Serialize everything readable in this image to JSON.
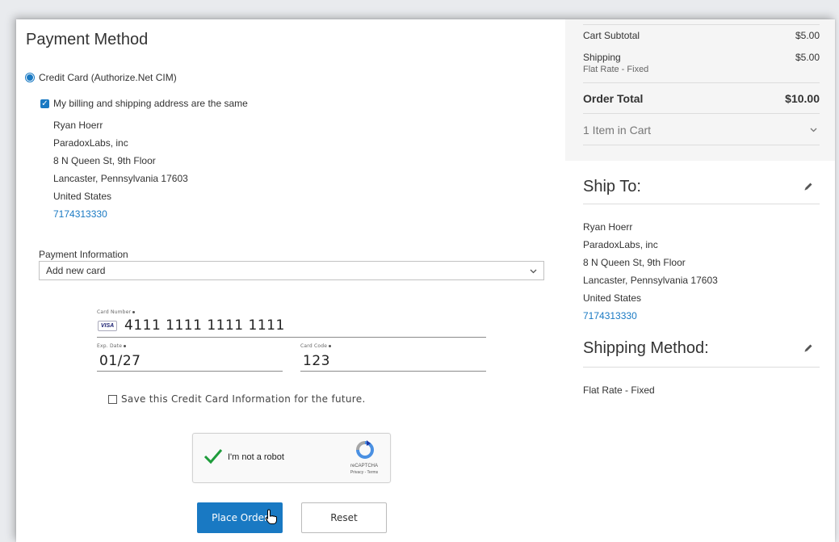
{
  "payment": {
    "title": "Payment Method",
    "method_label": "Credit Card (Authorize.Net CIM)",
    "same_address_label": "My billing and shipping address are the same",
    "billing_address": [
      "Ryan Hoerr",
      "ParadoxLabs, inc",
      "8 N Queen St, 9th Floor",
      "Lancaster, Pennsylvania 17603",
      "United States"
    ],
    "billing_phone": "7174313330",
    "info_label": "Payment Information",
    "card_select_value": "Add new card",
    "card_number_label": "Card Number",
    "card_brand": "VISA",
    "card_number": "4111 1111 1111 1111",
    "exp_label": "Exp. Date",
    "exp_value": "01/27",
    "cvv_label": "Card Code",
    "cvv_value": "123",
    "save_card_label": "Save this Credit Card Information for the future."
  },
  "captcha": {
    "label": "I'm not a robot",
    "brand": "reCAPTCHA",
    "links": "Privacy - Terms"
  },
  "actions": {
    "place_order": "Place Order",
    "reset": "Reset"
  },
  "summary": {
    "subtotal_label": "Cart Subtotal",
    "subtotal_value": "$5.00",
    "shipping_label": "Shipping",
    "shipping_value": "$5.00",
    "shipping_method": "Flat Rate - Fixed",
    "total_label": "Order Total",
    "total_value": "$10.00",
    "items_label": "1 Item in Cart"
  },
  "ship_to": {
    "title": "Ship To:",
    "address": [
      "Ryan Hoerr",
      "ParadoxLabs, inc",
      "8 N Queen St, 9th Floor",
      "Lancaster, Pennsylvania 17603",
      "United States"
    ],
    "phone": "7174313330"
  },
  "shipping_method": {
    "title": "Shipping Method:",
    "value": "Flat Rate - Fixed"
  },
  "colors": {
    "accent": "#1979c3",
    "summary_bg": "#f5f5f5"
  },
  "icons": {
    "edit": "pencil-icon",
    "chevron": "chevron-down-icon",
    "check": "checkmark-icon",
    "captcha": "recaptcha-logo-icon"
  }
}
